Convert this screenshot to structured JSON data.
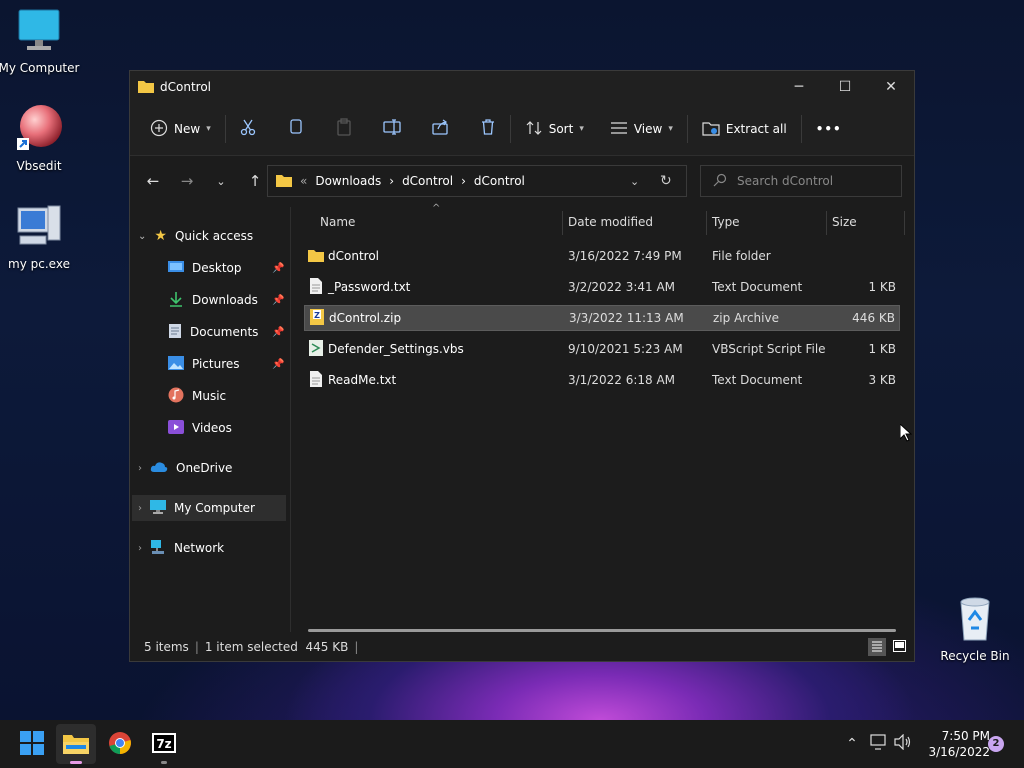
{
  "desktop": {
    "icons": [
      {
        "label": "My Computer",
        "icon": "monitor-icon"
      },
      {
        "label": "Vbsedit",
        "icon": "vbsedit-ball-icon"
      },
      {
        "label": "my pc.exe",
        "icon": "pc-exe-icon"
      },
      {
        "label": "Recycle Bin",
        "icon": "recycle-bin-icon"
      }
    ]
  },
  "window": {
    "title": "dControl",
    "controls": {
      "minimize": "─",
      "maximize": "☐",
      "close": "✕"
    },
    "toolbar": {
      "new_label": "New",
      "sort_label": "Sort",
      "view_label": "View",
      "extract_label": "Extract all",
      "more_label": "•••"
    },
    "address": {
      "prefix": "«",
      "crumbs": [
        "Downloads",
        "dControl",
        "dControl"
      ],
      "separator": "›"
    },
    "search": {
      "placeholder": "Search dControl"
    },
    "sidebar": {
      "quick_access": "Quick access",
      "quick_items": [
        {
          "label": "Desktop",
          "icon": "desktop-icon",
          "pinned": true
        },
        {
          "label": "Downloads",
          "icon": "download-icon",
          "pinned": true
        },
        {
          "label": "Documents",
          "icon": "documents-icon",
          "pinned": true
        },
        {
          "label": "Pictures",
          "icon": "pictures-icon",
          "pinned": true
        },
        {
          "label": "Music",
          "icon": "music-icon",
          "pinned": false
        },
        {
          "label": "Videos",
          "icon": "videos-icon",
          "pinned": false
        }
      ],
      "onedrive": "OneDrive",
      "my_computer": "My Computer",
      "network": "Network"
    },
    "columns": {
      "name": "Name",
      "date": "Date modified",
      "type": "Type",
      "size": "Size"
    },
    "files": [
      {
        "name": "dControl",
        "date": "3/16/2022 7:49 PM",
        "type": "File folder",
        "size": "",
        "icon": "folder-icon"
      },
      {
        "name": "_Password.txt",
        "date": "3/2/2022 3:41 AM",
        "type": "Text Document",
        "size": "1 KB",
        "icon": "text-file-icon"
      },
      {
        "name": "dControl.zip",
        "date": "3/3/2022 11:13 AM",
        "type": "zip Archive",
        "size": "446 KB",
        "icon": "zip-file-icon"
      },
      {
        "name": "Defender_Settings.vbs",
        "date": "9/10/2021 5:23 AM",
        "type": "VBScript Script File",
        "size": "1 KB",
        "icon": "vbs-file-icon"
      },
      {
        "name": "ReadMe.txt",
        "date": "3/1/2022 6:18 AM",
        "type": "Text Document",
        "size": "3 KB",
        "icon": "text-file-icon"
      }
    ],
    "selected_index": 2,
    "status": {
      "items": "5 items",
      "selected": "1 item selected  445 KB"
    }
  },
  "taskbar": {
    "time": "7:50 PM",
    "date": "3/16/2022",
    "notifications": "2",
    "apps": [
      "start-icon",
      "file-explorer-icon",
      "chrome-icon",
      "7zip-icon"
    ]
  },
  "colors": {
    "accent": "#0078d4",
    "folder": "#f3c745",
    "selection": "#4a4a4a"
  }
}
